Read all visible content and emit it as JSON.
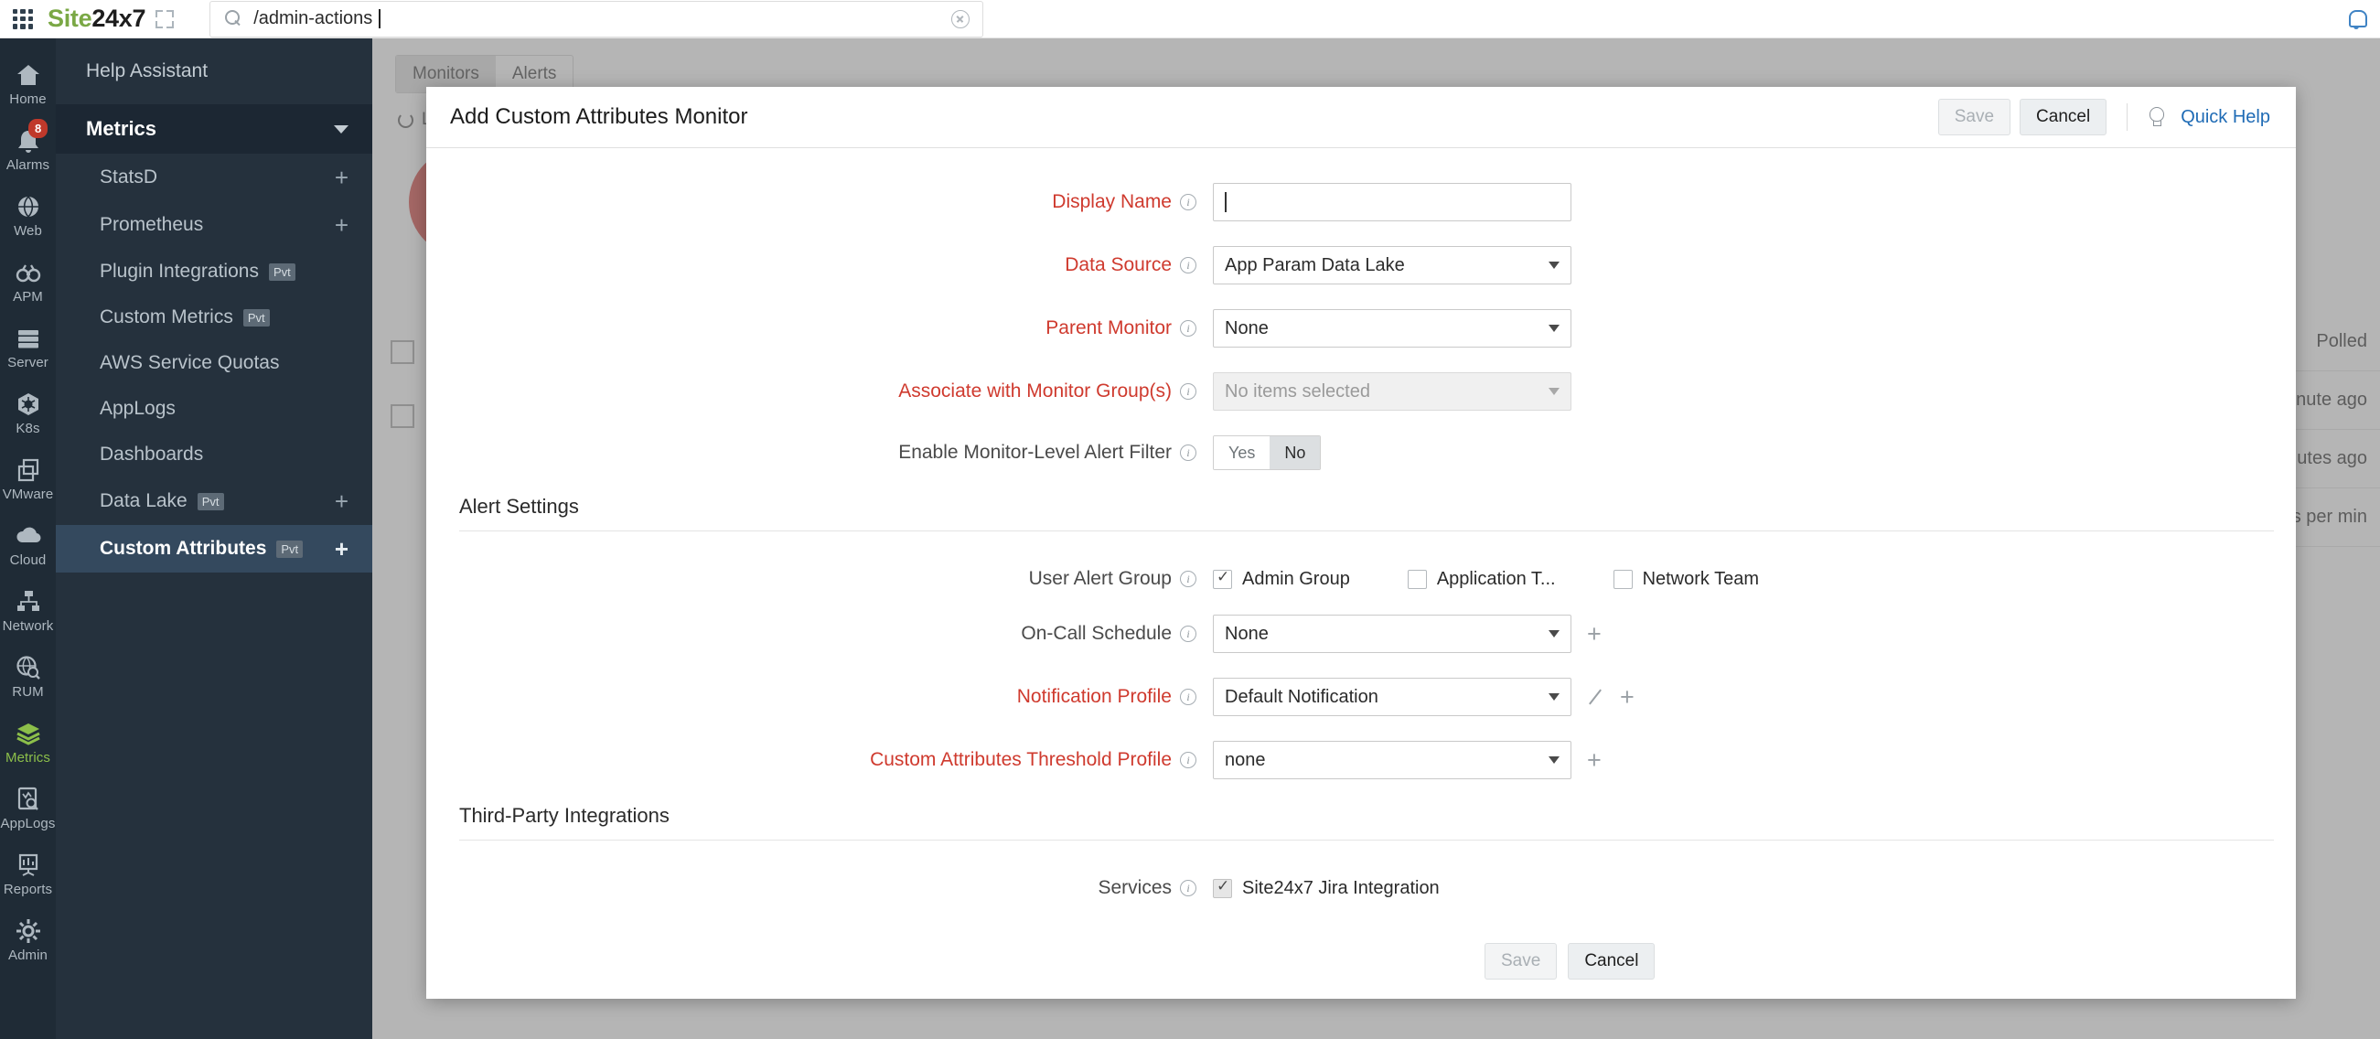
{
  "topbar": {
    "logo_site": "Site",
    "logo_247": "24x7",
    "search_value": "/admin-actions",
    "search_placeholder": "Search",
    "grid_icon": "apps-grid-icon",
    "expand_icon": "expand-icon",
    "clear_icon": "clear-icon",
    "notification_icon": "bell-icon"
  },
  "rail": {
    "items": [
      {
        "label": "Home",
        "icon": "home-icon",
        "badge": "",
        "active": false
      },
      {
        "label": "Alarms",
        "icon": "bell-icon",
        "badge": "8",
        "active": false
      },
      {
        "label": "Web",
        "icon": "globe-icon",
        "badge": "",
        "active": false
      },
      {
        "label": "APM",
        "icon": "binocular-icon",
        "badge": "",
        "active": false
      },
      {
        "label": "Server",
        "icon": "server-icon",
        "badge": "",
        "active": false
      },
      {
        "label": "K8s",
        "icon": "kubernetes-icon",
        "badge": "",
        "active": false
      },
      {
        "label": "VMware",
        "icon": "vmware-icon",
        "badge": "",
        "active": false
      },
      {
        "label": "Cloud",
        "icon": "cloud-icon",
        "badge": "",
        "active": false
      },
      {
        "label": "Network",
        "icon": "network-icon",
        "badge": "",
        "active": false
      },
      {
        "label": "RUM",
        "icon": "rum-globe-icon",
        "badge": "",
        "active": false
      },
      {
        "label": "Metrics",
        "icon": "layers-icon",
        "badge": "",
        "active": true
      },
      {
        "label": "AppLogs",
        "icon": "applogs-icon",
        "badge": "",
        "active": false
      },
      {
        "label": "Reports",
        "icon": "reports-icon",
        "badge": "",
        "active": false
      },
      {
        "label": "Admin",
        "icon": "gear-icon",
        "badge": "",
        "active": false
      }
    ]
  },
  "subnav": {
    "help_assistant": "Help Assistant",
    "section_title": "Metrics",
    "items": [
      {
        "label": "StatsD",
        "pvt": "",
        "plus": "+",
        "selected": false
      },
      {
        "label": "Prometheus",
        "pvt": "",
        "plus": "+",
        "selected": false
      },
      {
        "label": "Plugin Integrations",
        "pvt": "Pvt",
        "plus": "",
        "selected": false
      },
      {
        "label": "Custom Metrics",
        "pvt": "Pvt",
        "plus": "",
        "selected": false
      },
      {
        "label": "AWS Service Quotas",
        "pvt": "",
        "plus": "",
        "selected": false
      },
      {
        "label": "AppLogs",
        "pvt": "",
        "plus": "",
        "selected": false
      },
      {
        "label": "Dashboards",
        "pvt": "",
        "plus": "",
        "selected": false
      },
      {
        "label": "Data Lake",
        "pvt": "Pvt",
        "plus": "+",
        "selected": false
      },
      {
        "label": "Custom Attributes",
        "pvt": "Pvt",
        "plus": "+",
        "selected": true
      }
    ]
  },
  "background": {
    "tabs": [
      {
        "label": "Monitors",
        "active": true
      },
      {
        "label": "Alerts",
        "active": false
      }
    ],
    "subtitle": "Last updated a few seconds ago",
    "table_rows": [
      "Polled",
      "inute ago",
      "inutes ago",
      "ests per min"
    ]
  },
  "modal": {
    "title": "Add Custom Attributes Monitor",
    "header": {
      "save_label": "Save",
      "cancel_label": "Cancel",
      "quick_help_label": "Quick Help",
      "bulb_icon": "lightbulb-icon"
    },
    "fields": {
      "display_name": {
        "label": "Display Name",
        "value": "",
        "required": true
      },
      "data_source": {
        "label": "Data Source",
        "value": "App Param Data Lake",
        "required": true
      },
      "parent_monitor": {
        "label": "Parent Monitor",
        "value": "None",
        "required": true
      },
      "monitor_groups": {
        "label": "Associate with Monitor Group(s)",
        "value": "No items selected",
        "required": true,
        "disabled": true
      },
      "alert_filter": {
        "label": "Enable Monitor-Level Alert Filter",
        "required": false,
        "options": [
          {
            "label": "Yes",
            "selected": false
          },
          {
            "label": "No",
            "selected": true
          }
        ]
      }
    },
    "alert_settings": {
      "title": "Alert Settings",
      "user_alert_group": {
        "label": "User Alert Group",
        "options": [
          {
            "label": "Admin Group",
            "checked": true
          },
          {
            "label": "Application T...",
            "checked": false
          },
          {
            "label": "Network Team",
            "checked": false
          }
        ]
      },
      "on_call_schedule": {
        "label": "On-Call Schedule",
        "value": "None",
        "required": false,
        "add": "+"
      },
      "notification_profile": {
        "label": "Notification Profile",
        "value": "Default Notification",
        "required": true,
        "edit": "edit-icon",
        "add": "+"
      },
      "threshold_profile": {
        "label": "Custom Attributes Threshold Profile",
        "value": "none",
        "required": true,
        "add": "+"
      }
    },
    "third_party": {
      "title": "Third-Party Integrations",
      "services": {
        "label": "Services",
        "options": [
          {
            "label": "Site24x7 Jira Integration",
            "checked": true
          }
        ]
      }
    },
    "footer": {
      "save_label": "Save",
      "cancel_label": "Cancel"
    }
  },
  "colors": {
    "brand_green": "#7aa845",
    "required_red": "#cf3a2e",
    "link_blue": "#1f6bb5",
    "badge_red": "#c0392b",
    "rail_bg": "#1f2b36",
    "subnav_bg": "#25313d",
    "selected_bg": "#34495e"
  }
}
